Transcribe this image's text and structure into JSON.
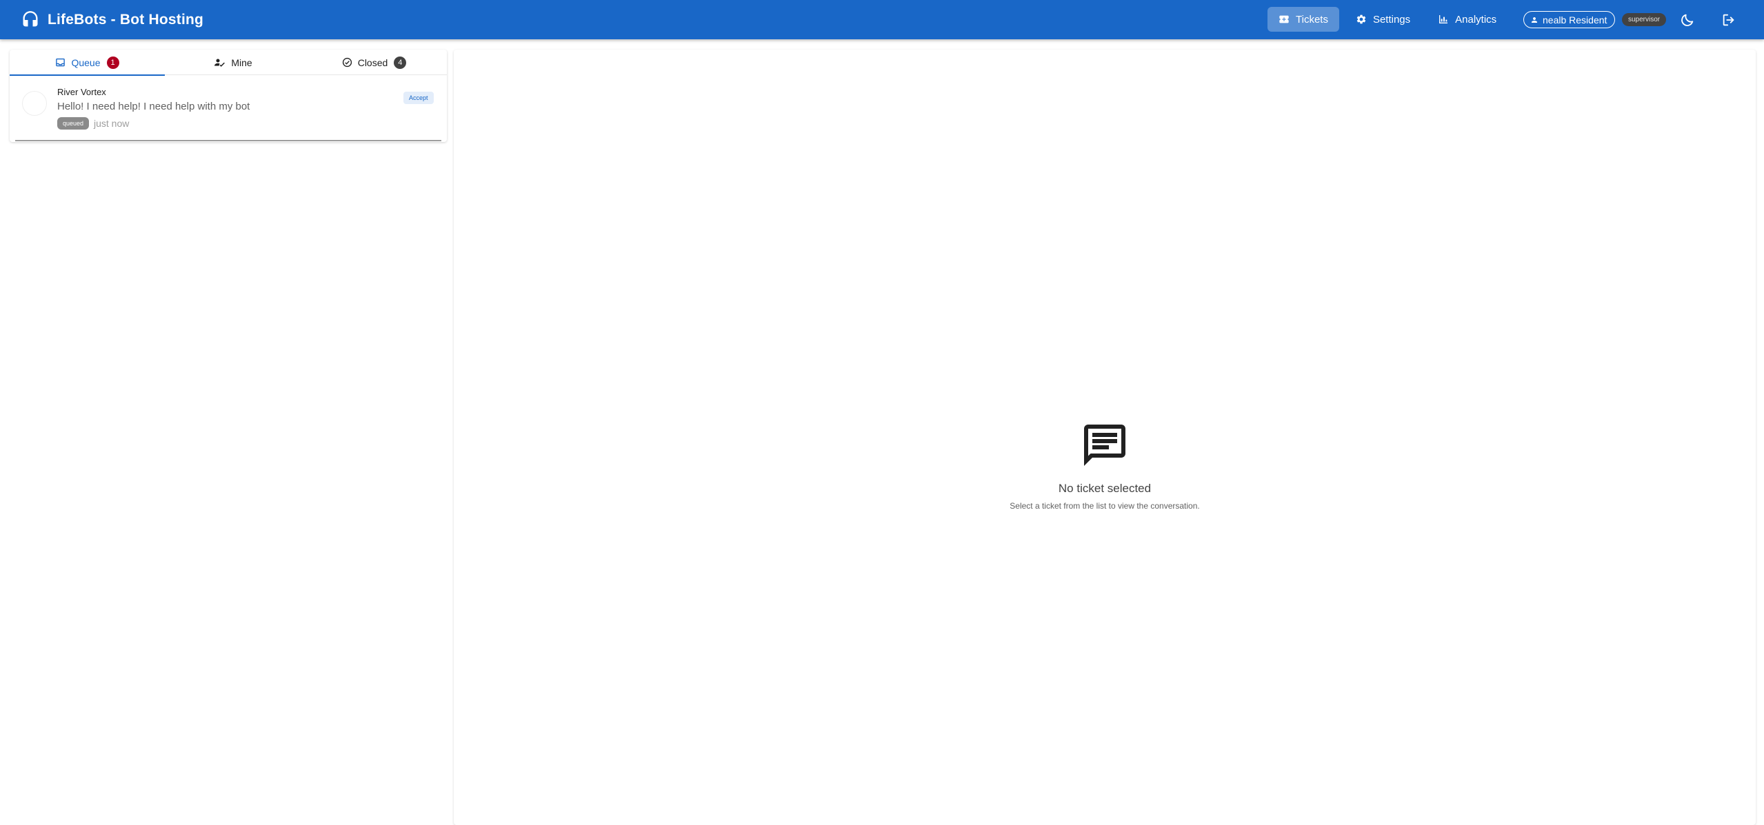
{
  "app": {
    "title": "LifeBots - Bot Hosting",
    "brand_color": "#1967c7"
  },
  "nav": {
    "tickets": "Tickets",
    "settings": "Settings",
    "analytics": "Analytics"
  },
  "user": {
    "name": "nealb Resident",
    "role": "supervisor"
  },
  "tabs": {
    "queue": {
      "label": "Queue",
      "count": "1"
    },
    "mine": {
      "label": "Mine"
    },
    "closed": {
      "label": "Closed",
      "count": "4"
    }
  },
  "tickets": [
    {
      "name": "River Vortex",
      "message": "Hello! I need help! I need help with my bot",
      "status": "queued",
      "time": "just now",
      "action": "Accept"
    }
  ],
  "empty_state": {
    "title": "No ticket selected",
    "subtitle": "Select a ticket from the list to view the conversation."
  },
  "icons": {
    "brand": "headset-icon",
    "tickets": "ticket-icon",
    "settings": "gear-icon",
    "analytics": "bar-chart-icon",
    "user": "person-icon",
    "theme": "moon-icon",
    "logout": "logout-icon",
    "queue": "inbox-icon",
    "mine": "person-check-icon",
    "closed": "check-circle-icon",
    "empty": "chat-message-icon"
  }
}
